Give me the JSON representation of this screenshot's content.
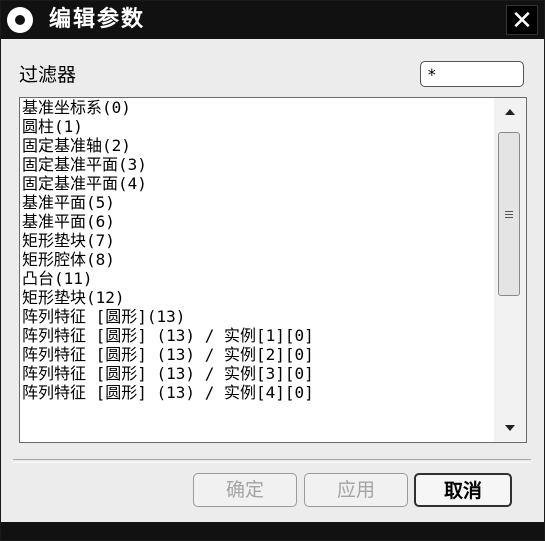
{
  "titlebar": {
    "title": "编辑参数",
    "icon": "gear-icon",
    "close_label": "✕"
  },
  "filter": {
    "label": "过滤器",
    "value": "*"
  },
  "list": {
    "items": [
      "基准坐标系(0)",
      "圆柱(1)",
      "固定基准轴(2)",
      "固定基准平面(3)",
      "固定基准平面(4)",
      "基准平面(5)",
      "基准平面(6)",
      "矩形垫块(7)",
      "矩形腔体(8)",
      "凸台(11)",
      "矩形垫块(12)",
      "阵列特征 [圆形](13)",
      "阵列特征 [圆形] (13) / 实例[1][0]",
      "阵列特征 [圆形] (13) / 实例[2][0]",
      "阵列特征 [圆形] (13) / 实例[3][0]",
      "阵列特征 [圆形] (13) / 实例[4][0]"
    ]
  },
  "buttons": {
    "ok": "确定",
    "apply": "应用",
    "cancel": "取消"
  },
  "colors": {
    "titlebar": "#111111",
    "disabled_text": "#a4a4a4",
    "background": "#ececec"
  }
}
